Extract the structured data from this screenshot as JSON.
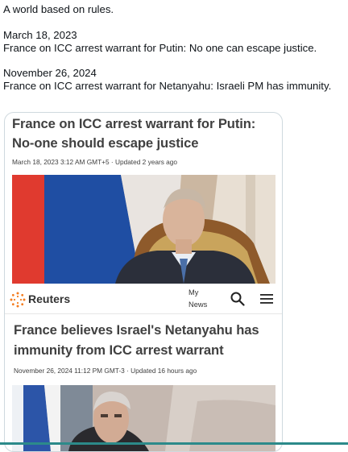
{
  "tweet": {
    "line1": "A world based on rules.",
    "date1": "March 18, 2023",
    "line2": "France on ICC arrest warrant for Putin: No one can escape justice.",
    "date2": "November 26, 2024",
    "line3": "France on ICC arrest warrant for Netanyahu: Israeli PM has immunity."
  },
  "card": {
    "article_a": {
      "headline": "France on ICC arrest warrant for Putin: No-one should escape justice",
      "meta": "March 18, 2023 3:12 AM GMT+5 · Updated 2 years ago"
    },
    "site_header": {
      "logo_text": "Reuters",
      "my_news_label": "My News",
      "search_icon": "search-icon",
      "menu_icon": "menu-icon"
    },
    "article_b": {
      "headline": "France believes Israel's Netanyahu has immunity from ICC arrest warrant",
      "meta": "November 26, 2024 11:12 PM GMT-3 · Updated 16 hours ago"
    }
  },
  "colors": {
    "reuters_orange": "#f47d20",
    "headline_gray": "#404040",
    "flag_blue": "#1f4ea3",
    "flag_red": "#e03a2f"
  }
}
